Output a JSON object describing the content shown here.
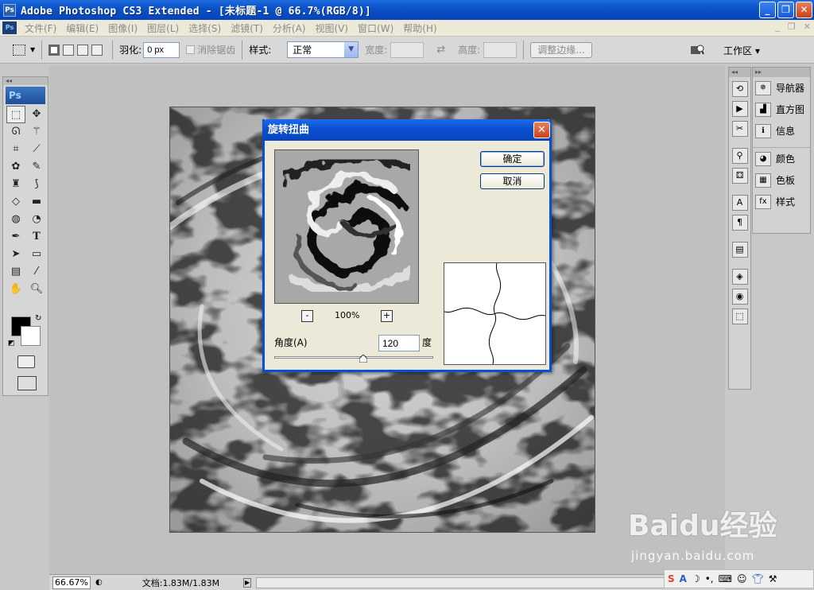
{
  "window": {
    "title": "Adobe Photoshop CS3 Extended - [未标题-1 @ 66.7%(RGB/8)]",
    "app_icon": "Ps"
  },
  "menubar": {
    "items": [
      "文件(F)",
      "编辑(E)",
      "图像(I)",
      "图层(L)",
      "选择(S)",
      "滤镜(T)",
      "分析(A)",
      "视图(V)",
      "窗口(W)",
      "帮助(H)"
    ]
  },
  "options": {
    "feather_label": "羽化:",
    "feather_value": "0 px",
    "antialias_label": "消除锯齿",
    "style_label": "样式:",
    "style_value": "正常",
    "width_label": "宽度:",
    "height_label": "高度:",
    "refine_edge": "调整边缘...",
    "workspace": "工作区 ▾"
  },
  "toolbox": {
    "logo": "Ps"
  },
  "dialog": {
    "title": "旋转扭曲",
    "ok": "确定",
    "cancel": "取消",
    "zoom_minus": "-",
    "zoom_plus": "+",
    "zoom_value": "100%",
    "angle_label": "角度(A)",
    "angle_value": "120",
    "degree_unit": "度",
    "angle_slider_value": 120,
    "angle_slider_range": [
      -999,
      999
    ]
  },
  "panels": {
    "group1": [
      "导航器",
      "直方图",
      "信息"
    ],
    "group2": [
      "颜色",
      "色板",
      "样式"
    ]
  },
  "status": {
    "zoom": "66.67%",
    "doc": "文档:1.83M/1.83M"
  },
  "watermark": {
    "line1": "Baidu经验",
    "line2": "jingyan.baidu.com"
  },
  "colors": {
    "titlebar": "#0a52c9",
    "foreground": "#000000",
    "background": "#ffffff"
  }
}
